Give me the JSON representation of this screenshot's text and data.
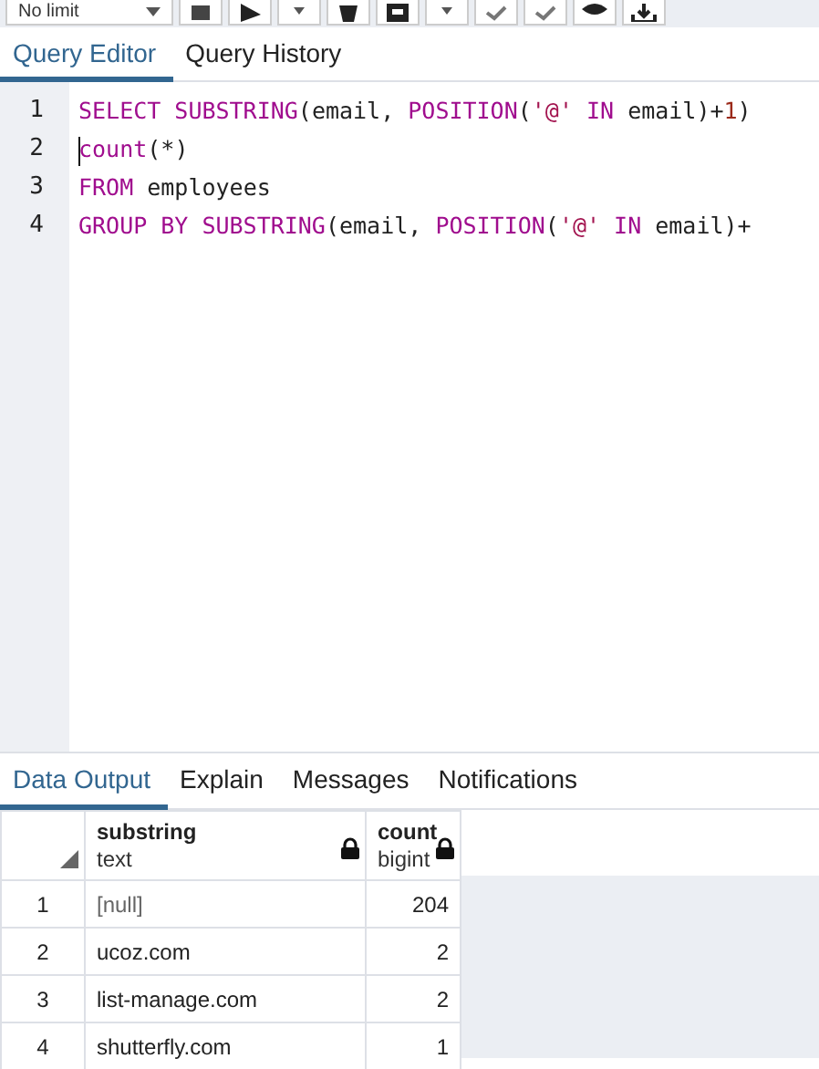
{
  "toolbar": {
    "limit": "No limit"
  },
  "editor_tabs": [
    {
      "label": "Query Editor",
      "selected": true
    },
    {
      "label": "Query History",
      "selected": false
    }
  ],
  "code_lines": [
    {
      "number": "1",
      "tokens": [
        {
          "kind": "keyword",
          "text": "SELECT SUBSTRING"
        },
        {
          "kind": "plain",
          "text": "(email, "
        },
        {
          "kind": "keyword",
          "text": "POSITION"
        },
        {
          "kind": "plain",
          "text": "("
        },
        {
          "kind": "string",
          "text": "'@'"
        },
        {
          "kind": "keyword",
          "text": " IN "
        },
        {
          "kind": "plain",
          "text": "email)+"
        },
        {
          "kind": "number",
          "text": "1"
        },
        {
          "kind": "plain",
          "text": ")"
        }
      ]
    },
    {
      "number": "2",
      "cursor": true,
      "tokens": [
        {
          "kind": "keyword",
          "text": "count"
        },
        {
          "kind": "plain",
          "text": "(*)"
        }
      ]
    },
    {
      "number": "3",
      "tokens": [
        {
          "kind": "keyword",
          "text": "FROM"
        },
        {
          "kind": "plain",
          "text": " employees"
        }
      ]
    },
    {
      "number": "4",
      "tokens": [
        {
          "kind": "keyword",
          "text": "GROUP BY SUBSTRING"
        },
        {
          "kind": "plain",
          "text": "(email, "
        },
        {
          "kind": "keyword",
          "text": "POSITION"
        },
        {
          "kind": "plain",
          "text": "("
        },
        {
          "kind": "string",
          "text": "'@'"
        },
        {
          "kind": "keyword",
          "text": " IN "
        },
        {
          "kind": "plain",
          "text": "email)+"
        }
      ]
    }
  ],
  "output_tabs": [
    {
      "label": "Data Output",
      "selected": true
    },
    {
      "label": "Explain",
      "selected": false
    },
    {
      "label": "Messages",
      "selected": false
    },
    {
      "label": "Notifications",
      "selected": false
    }
  ],
  "table": {
    "columns": [
      {
        "name": "substring",
        "type": "text",
        "kind": "text"
      },
      {
        "name": "count",
        "type": "bigint",
        "kind": "number"
      }
    ],
    "rows": [
      {
        "number": "1",
        "cells": [
          {
            "text": "[null]",
            "null": true
          },
          {
            "text": "204",
            "null": false
          }
        ]
      },
      {
        "number": "2",
        "cells": [
          {
            "text": "ucoz.com",
            "null": false
          },
          {
            "text": "2",
            "null": false
          }
        ]
      },
      {
        "number": "3",
        "cells": [
          {
            "text": "list-manage.com",
            "null": false
          },
          {
            "text": "2",
            "null": false
          }
        ]
      },
      {
        "number": "4",
        "cells": [
          {
            "text": "shutterfly.com",
            "null": false
          },
          {
            "text": "1",
            "null": false
          }
        ]
      }
    ]
  }
}
